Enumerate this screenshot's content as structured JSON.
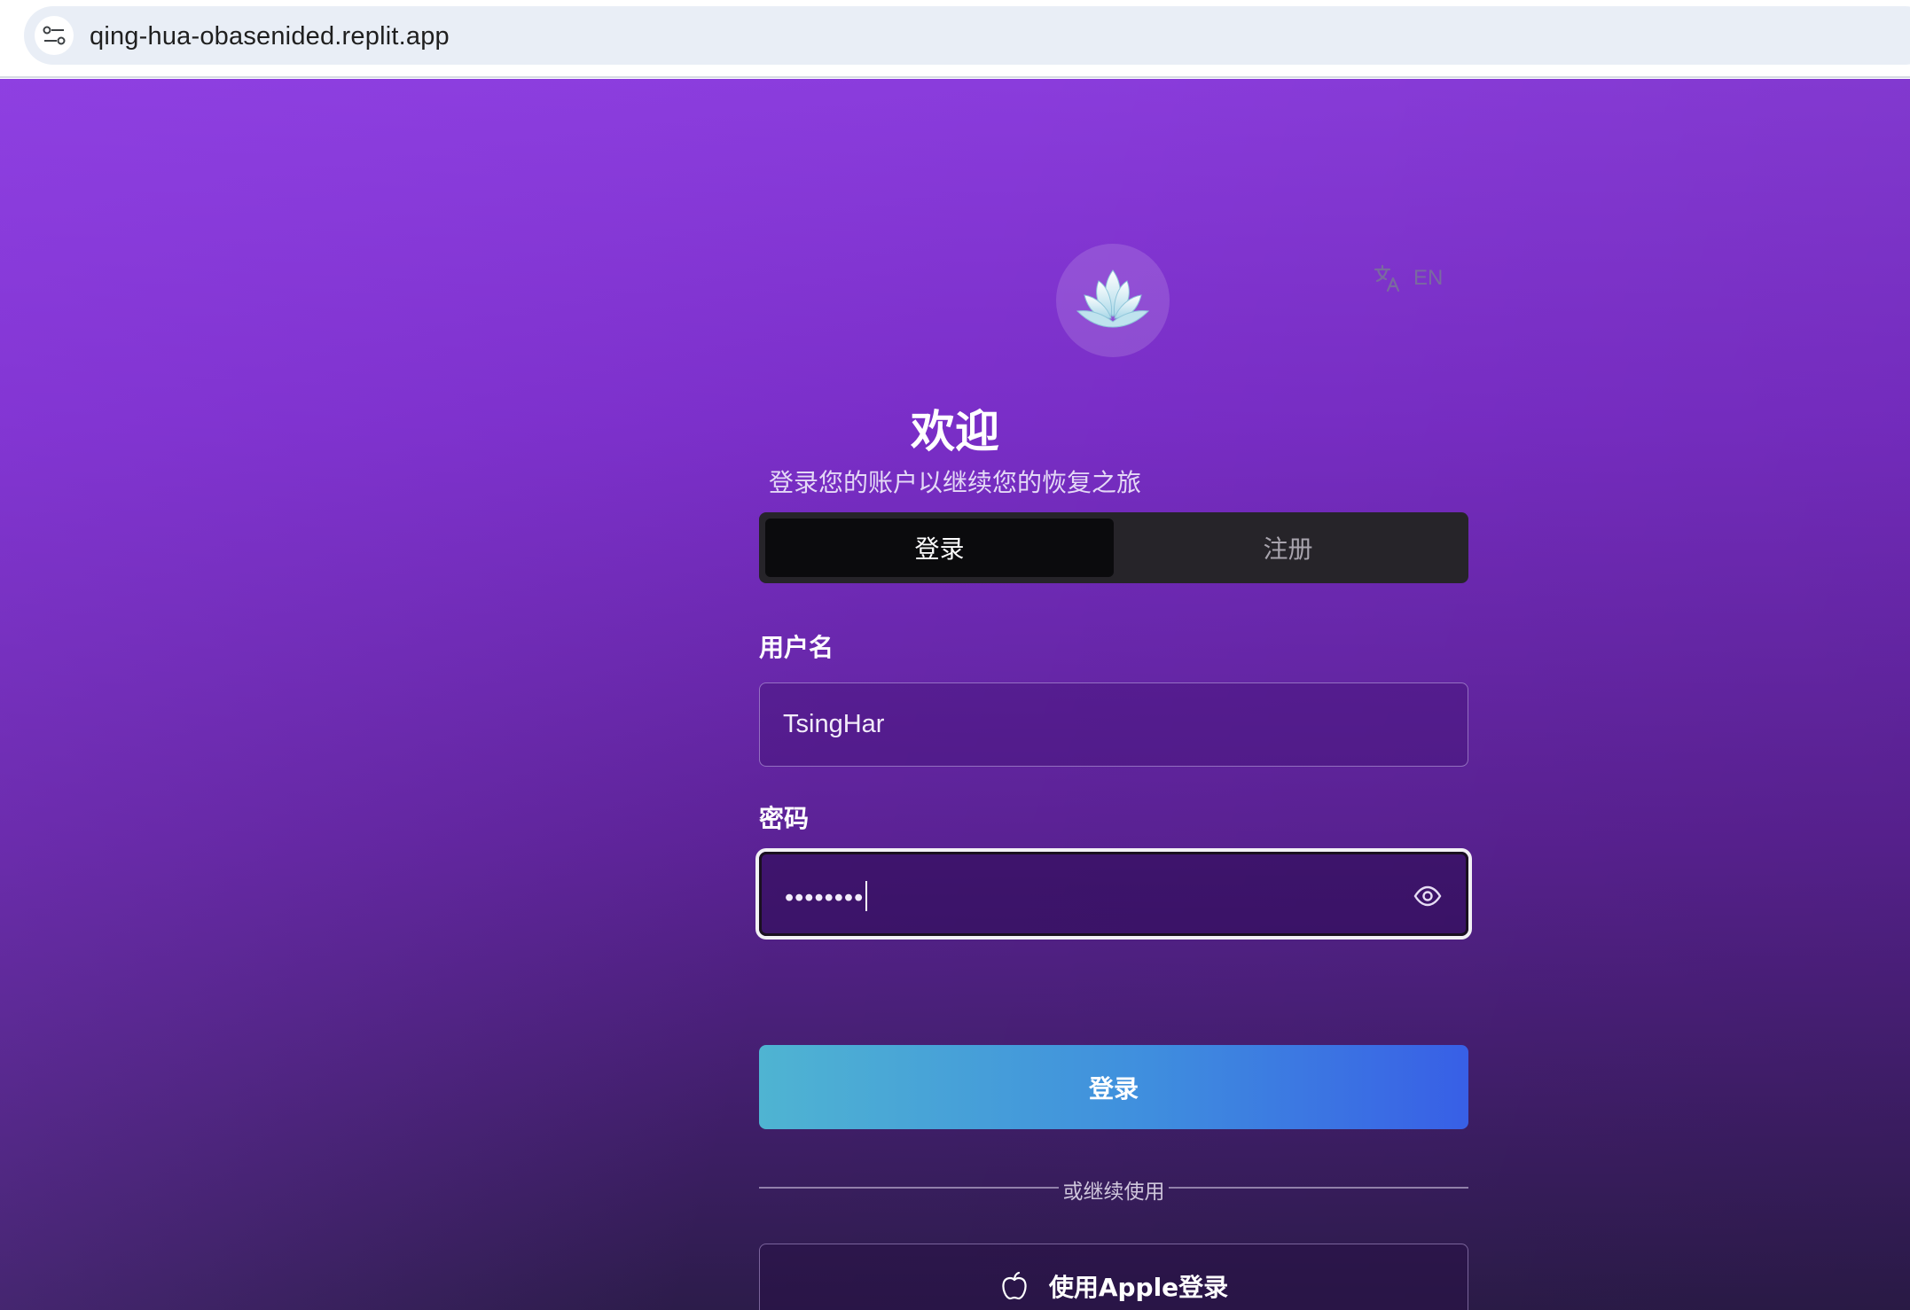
{
  "browser": {
    "url": "qing-hua-obasenided.replit.app"
  },
  "header": {
    "language_label": "EN",
    "title": "欢迎",
    "subtitle": "登录您的账户以继续您的恢复之旅"
  },
  "tabs": [
    {
      "label": "登录",
      "active": true
    },
    {
      "label": "注册",
      "active": false
    }
  ],
  "form": {
    "username_label": "用户名",
    "username_value": "TsingHar",
    "password_label": "密码",
    "password_value": "••••••••",
    "submit_label": "登录"
  },
  "divider_text": "或继续使用",
  "apple_button_label": "使用Apple登录",
  "colors": {
    "background_top": "#8a3cdc",
    "background_bottom": "#2c1c4a",
    "button_gradient_start": "#4fb4d2",
    "button_gradient_end": "#385fe6"
  },
  "icons": [
    "site-info-icon",
    "translate-icon",
    "lotus-logo-icon",
    "eye-icon",
    "apple-icon"
  ]
}
